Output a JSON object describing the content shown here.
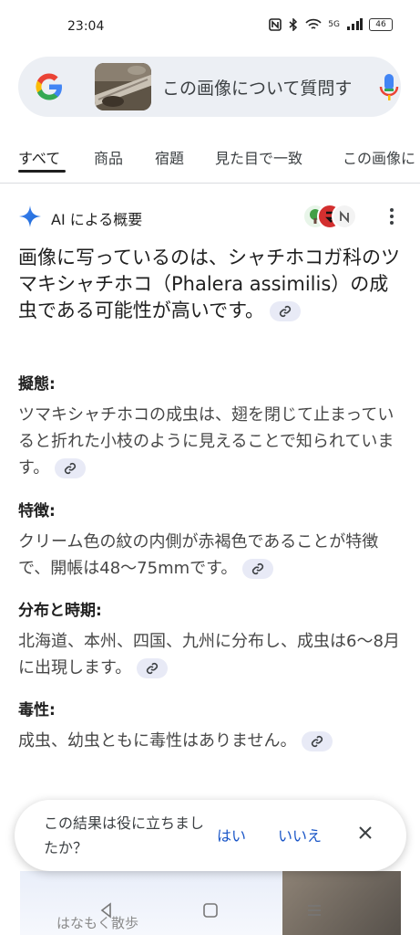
{
  "status_bar": {
    "time": "23:04",
    "network_label": "5G",
    "battery": "46"
  },
  "search": {
    "query_text": "この画像について質問す",
    "thumbnail": "moth-on-twig-thumbnail"
  },
  "tabs": [
    {
      "label": "すべて",
      "active": true
    },
    {
      "label": "商品",
      "active": false
    },
    {
      "label": "宿題",
      "active": false
    },
    {
      "label": "見た目で一致",
      "active": false
    },
    {
      "label": "この画像に",
      "active": false
    }
  ],
  "ai_overview": {
    "title": "AI による概要",
    "summary": "画像に写っているのは、シャチホコガ科のツマキシャチホコ（Phalera assimilis）の成虫である可能性が高いです。",
    "sections": [
      {
        "title": "擬態:",
        "body": "ツマキシャチホコの成虫は、翅を閉じて止まっていると折れた小枝のように見えることで知られています。"
      },
      {
        "title": "特徴:",
        "body": "クリーム色の紋の内側が赤褐色であることが特徴で、開帳は48〜75mmです。"
      },
      {
        "title": "分布と時期:",
        "body": "北海道、本州、四国、九州に分布し、成虫は6〜8月に出現します。"
      },
      {
        "title": "毒性:",
        "body": "成虫、幼虫ともに毒性はありません。"
      }
    ]
  },
  "feedback": {
    "question": "この結果は役に立ちましたか？",
    "yes_label": "はい",
    "no_label": "いいえ"
  },
  "bottom_card": {
    "source_text": "はなもく散歩"
  },
  "colors": {
    "accent_blue": "#1a56c7",
    "search_bg": "#eceff4",
    "chip_bg": "#e8eaf6"
  }
}
